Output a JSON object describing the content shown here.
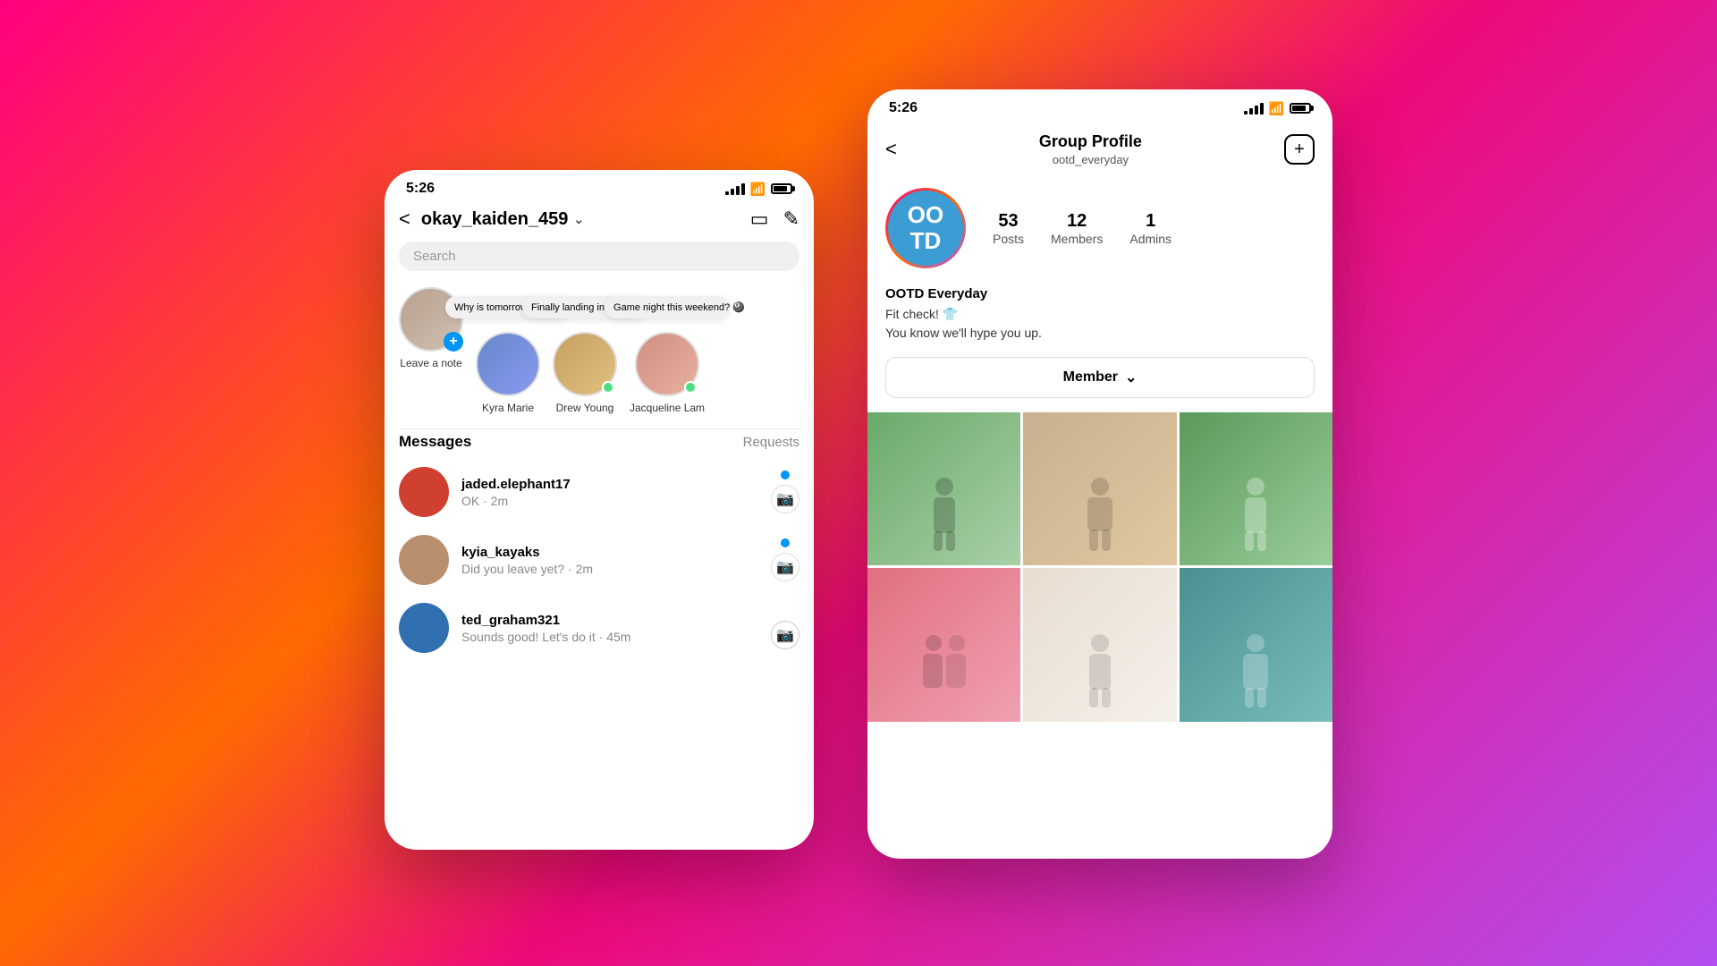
{
  "background": {
    "gradient_start": "#ff0080",
    "gradient_end": "#b44ff0"
  },
  "left_phone": {
    "status_bar": {
      "time": "5:26"
    },
    "header": {
      "username": "okay_kaiden_459",
      "back_label": "<",
      "chevron": "∨"
    },
    "search_placeholder": "Search",
    "notes": [
      {
        "id": "self",
        "label": "Leave a note",
        "has_add": true,
        "online": false,
        "note": null
      },
      {
        "id": "kyra",
        "label": "Kyra Marie",
        "has_add": false,
        "online": false,
        "note": "Why is tomorrow Monday!? 😩"
      },
      {
        "id": "drew",
        "label": "Drew Young",
        "has_add": false,
        "online": true,
        "note": "Finally landing in NYC! ❤️"
      },
      {
        "id": "jacqueline",
        "label": "Jacqueline Lam",
        "has_add": false,
        "online": true,
        "note": "Game night this weekend? 🎱"
      }
    ],
    "messages_title": "Messages",
    "requests_label": "Requests",
    "messages": [
      {
        "username": "jaded.elephant17",
        "preview": "OK · 2m",
        "unread": true,
        "avatar_color": "avatar-red"
      },
      {
        "username": "kyia_kayaks",
        "preview": "Did you leave yet? · 2m",
        "unread": true,
        "avatar_color": "avatar-tan"
      },
      {
        "username": "ted_graham321",
        "preview": "Sounds good! Let's do it · 45m",
        "unread": false,
        "avatar_color": "avatar-blue"
      }
    ]
  },
  "right_phone": {
    "status_bar": {
      "time": "5:26"
    },
    "header": {
      "title": "Group Profile",
      "subtitle": "ootd_everyday",
      "back_label": "<",
      "add_label": "+"
    },
    "group": {
      "avatar_text": "OO\nTD",
      "stats": [
        {
          "num": "53",
          "label": "Posts"
        },
        {
          "num": "12",
          "label": "Members"
        },
        {
          "num": "1",
          "label": "Admins"
        }
      ],
      "name": "OOTD Everyday",
      "bio_lines": [
        "Fit check! 👕",
        "You know we'll hype you up."
      ],
      "member_btn_label": "Member",
      "chevron": "∨"
    },
    "photos": [
      {
        "id": "p1",
        "color": "photo-green"
      },
      {
        "id": "p2",
        "color": "photo-beige"
      },
      {
        "id": "p3",
        "color": "photo-green2"
      },
      {
        "id": "p4",
        "color": "photo-pink"
      },
      {
        "id": "p5",
        "color": "photo-ivory"
      },
      {
        "id": "p6",
        "color": "photo-teal"
      }
    ]
  }
}
